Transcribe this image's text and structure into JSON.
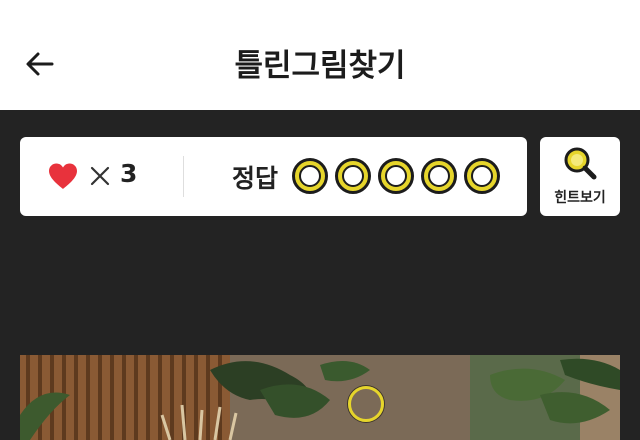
{
  "header": {
    "title": "틀린그림찾기",
    "back_icon": "arrow-left-icon"
  },
  "status": {
    "lives_icon": "heart-icon",
    "lives_separator_icon": "times-icon",
    "lives_count": "3",
    "answer_label": "정답",
    "answer_total": 5,
    "answers_found": 0,
    "slot_ring_color": "#e6d52b"
  },
  "hint": {
    "label": "힌트보기",
    "icon": "magnifier-icon"
  },
  "colors": {
    "background": "#232323",
    "heart": "#e8323c",
    "accent_yellow": "#e6d52b",
    "card": "#ffffff"
  }
}
